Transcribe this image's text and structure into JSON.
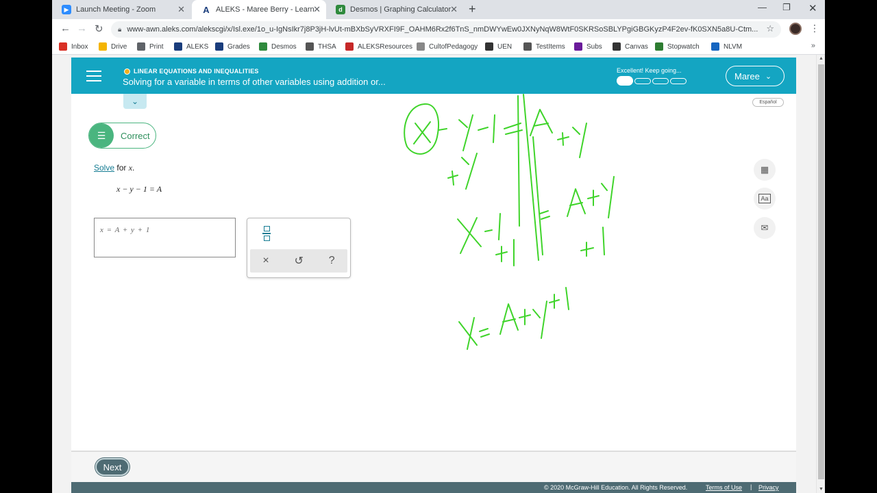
{
  "browser": {
    "tabs": [
      {
        "title": "Launch Meeting - Zoom",
        "icon": "zoom-icon",
        "color": "#2d8cff"
      },
      {
        "title": "ALEKS - Maree Berry - Learn",
        "icon": "aleks-icon",
        "color": "#1a3d7c"
      },
      {
        "title": "Desmos | Graphing Calculator",
        "icon": "desmos-icon",
        "color": "#2f8a3d"
      }
    ],
    "url": "www-awn.aleks.com/alekscgi/x/Isl.exe/1o_u-IgNsIkr7j8P3jH-lvUt-mBXbSyVRXFI9F_OAHM6Rx2f6TnS_nmDWYwEw0JXNyNqW8WtF0SKRSoSBLYPgiGBGKyzP4F2ev-fK0SXN5a8U-Ctm...",
    "bookmarks": [
      {
        "label": "Inbox",
        "icon": "gmail-icon",
        "color": "#d93025"
      },
      {
        "label": "Drive",
        "icon": "drive-icon",
        "color": "#f4b400"
      },
      {
        "label": "Print",
        "icon": "print-icon",
        "color": "#5f6368"
      },
      {
        "label": "ALEKS",
        "icon": "aleks-icon",
        "color": "#1a3d7c"
      },
      {
        "label": "Grades",
        "icon": "grades-icon",
        "color": "#1a3d7c"
      },
      {
        "label": "Desmos",
        "icon": "desmos-icon",
        "color": "#2f8a3d"
      },
      {
        "label": "THSA",
        "icon": "thsa-icon",
        "color": "#555555"
      },
      {
        "label": "ALEKSResources",
        "icon": "mcgraw-hill-icon",
        "color": "#c62828"
      },
      {
        "label": "CultofPedagogy",
        "icon": "cult-icon",
        "color": "#888888"
      },
      {
        "label": "UEN",
        "icon": "uen-icon",
        "color": "#333333"
      },
      {
        "label": "TestItems",
        "icon": "flag-icon",
        "color": "#555555"
      },
      {
        "label": "Subs",
        "icon": "subs-icon",
        "color": "#6a1b9a"
      },
      {
        "label": "Canvas",
        "icon": "canvas-icon",
        "color": "#333333"
      },
      {
        "label": "Stopwatch",
        "icon": "stopwatch-icon",
        "color": "#2e7d32"
      },
      {
        "label": "NLVM",
        "icon": "nlvm-icon",
        "color": "#1565c0"
      }
    ]
  },
  "header": {
    "topic": "LINEAR EQUATIONS AND INEQUALITIES",
    "title": "Solving for a variable in terms of other variables using addition or...",
    "progress_text": "Excellent! Keep going...",
    "progress_fraction": 0.25,
    "user": "Maree",
    "accent": "#14a5c2"
  },
  "language_toggle": "Español",
  "feedback": {
    "label": "Correct",
    "color": "#4ab57f"
  },
  "problem": {
    "verb": "Solve",
    "middle": " for ",
    "variable": "x",
    "end": ".",
    "equation": "x − y − 1 = A"
  },
  "answer": {
    "value": "x = A + y + 1"
  },
  "tools": {
    "clear": "×",
    "undo": "↺",
    "help": "?"
  },
  "side_tools": [
    "calculator-icon",
    "dictionary-icon",
    "mail-icon"
  ],
  "footer": {
    "next": "Next",
    "copyright": "© 2020 McGraw-Hill Education. All Rights Reserved.",
    "terms": "Terms of Use",
    "separator": "|",
    "privacy": "Privacy"
  }
}
